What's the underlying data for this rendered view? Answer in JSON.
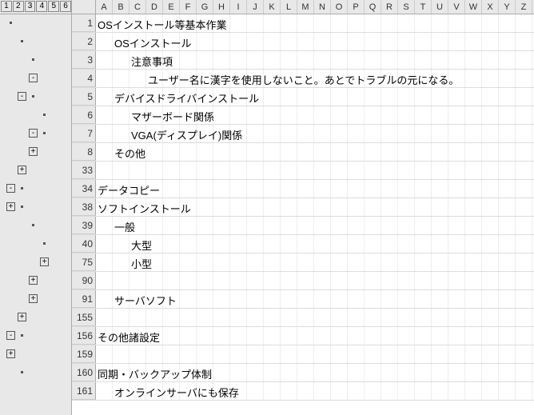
{
  "levels": [
    "1",
    "2",
    "3",
    "4",
    "5",
    "6"
  ],
  "columns": [
    "A",
    "B",
    "C",
    "D",
    "E",
    "F",
    "G",
    "H",
    "I",
    "J",
    "K",
    "L",
    "M",
    "N",
    "O",
    "P",
    "Q",
    "R",
    "S",
    "T",
    "U",
    "V",
    "W",
    "X",
    "Y",
    "Z"
  ],
  "rows": [
    {
      "num": "1",
      "col": "A",
      "text": "OSインストール等基本作業",
      "outline": [
        {
          "type": "dot",
          "lvl": 1
        }
      ]
    },
    {
      "num": "2",
      "col": "B",
      "text": "OSインストール",
      "outline": [
        {
          "type": "dot",
          "lvl": 2
        }
      ]
    },
    {
      "num": "3",
      "col": "C",
      "text": "注意事項",
      "outline": [
        {
          "type": "dot",
          "lvl": 3
        }
      ]
    },
    {
      "num": "4",
      "col": "D",
      "text": "ユーザー名に漢字を使用しないこと。あとでトラブルの元になる。",
      "outline": [
        {
          "type": "btn",
          "sym": "-",
          "lvl": 3
        }
      ]
    },
    {
      "num": "5",
      "col": "B",
      "text": "デバイスドライバインストール",
      "outline": [
        {
          "type": "btn",
          "sym": "-",
          "lvl": 2
        },
        {
          "type": "dot",
          "lvl": 3
        }
      ]
    },
    {
      "num": "6",
      "col": "C",
      "text": "マザーボード関係",
      "outline": [
        {
          "type": "dot",
          "lvl": 4
        }
      ]
    },
    {
      "num": "7",
      "col": "C",
      "text": "VGA(ディスプレイ)関係",
      "outline": [
        {
          "type": "btn",
          "sym": "-",
          "lvl": 3
        },
        {
          "type": "dot",
          "lvl": 4
        }
      ]
    },
    {
      "num": "8",
      "col": "B",
      "text": "その他",
      "outline": [
        {
          "type": "btn",
          "sym": "+",
          "lvl": 3
        }
      ]
    },
    {
      "num": "33",
      "col": "",
      "text": "",
      "outline": [
        {
          "type": "btn",
          "sym": "+",
          "lvl": 2
        }
      ]
    },
    {
      "num": "34",
      "col": "A",
      "text": "データコピー",
      "outline": [
        {
          "type": "btn",
          "sym": "-",
          "lvl": 1
        },
        {
          "type": "dot",
          "lvl": 2
        }
      ]
    },
    {
      "num": "38",
      "col": "A",
      "text": "ソフトインストール",
      "outline": [
        {
          "type": "btn",
          "sym": "+",
          "lvl": 1
        },
        {
          "type": "dot",
          "lvl": 2
        }
      ]
    },
    {
      "num": "39",
      "col": "B",
      "text": "一般",
      "outline": [
        {
          "type": "dot",
          "lvl": 3
        }
      ]
    },
    {
      "num": "40",
      "col": "C",
      "text": "大型",
      "outline": [
        {
          "type": "dot",
          "lvl": 4
        }
      ]
    },
    {
      "num": "75",
      "col": "C",
      "text": "小型",
      "outline": [
        {
          "type": "btn",
          "sym": "+",
          "lvl": 4
        }
      ]
    },
    {
      "num": "90",
      "col": "",
      "text": "",
      "outline": [
        {
          "type": "btn",
          "sym": "+",
          "lvl": 3
        }
      ]
    },
    {
      "num": "91",
      "col": "B",
      "text": "サーバソフト",
      "outline": [
        {
          "type": "btn",
          "sym": "+",
          "lvl": 3
        }
      ]
    },
    {
      "num": "155",
      "col": "",
      "text": "",
      "outline": [
        {
          "type": "btn",
          "sym": "+",
          "lvl": 2
        }
      ]
    },
    {
      "num": "156",
      "col": "A",
      "text": "その他諸設定",
      "outline": [
        {
          "type": "btn",
          "sym": "-",
          "lvl": 1
        },
        {
          "type": "dot",
          "lvl": 2
        }
      ]
    },
    {
      "num": "159",
      "col": "",
      "text": "",
      "outline": [
        {
          "type": "btn",
          "sym": "+",
          "lvl": 1
        }
      ]
    },
    {
      "num": "160",
      "col": "A",
      "text": "同期・バックアップ体制",
      "outline": [
        {
          "type": "dot",
          "lvl": 2
        }
      ]
    },
    {
      "num": "161",
      "col": "B",
      "text": "オンラインサーバにも保存",
      "outline": []
    }
  ],
  "colOffset": {
    "A": 0,
    "B": 21,
    "C": 42,
    "D": 63
  }
}
